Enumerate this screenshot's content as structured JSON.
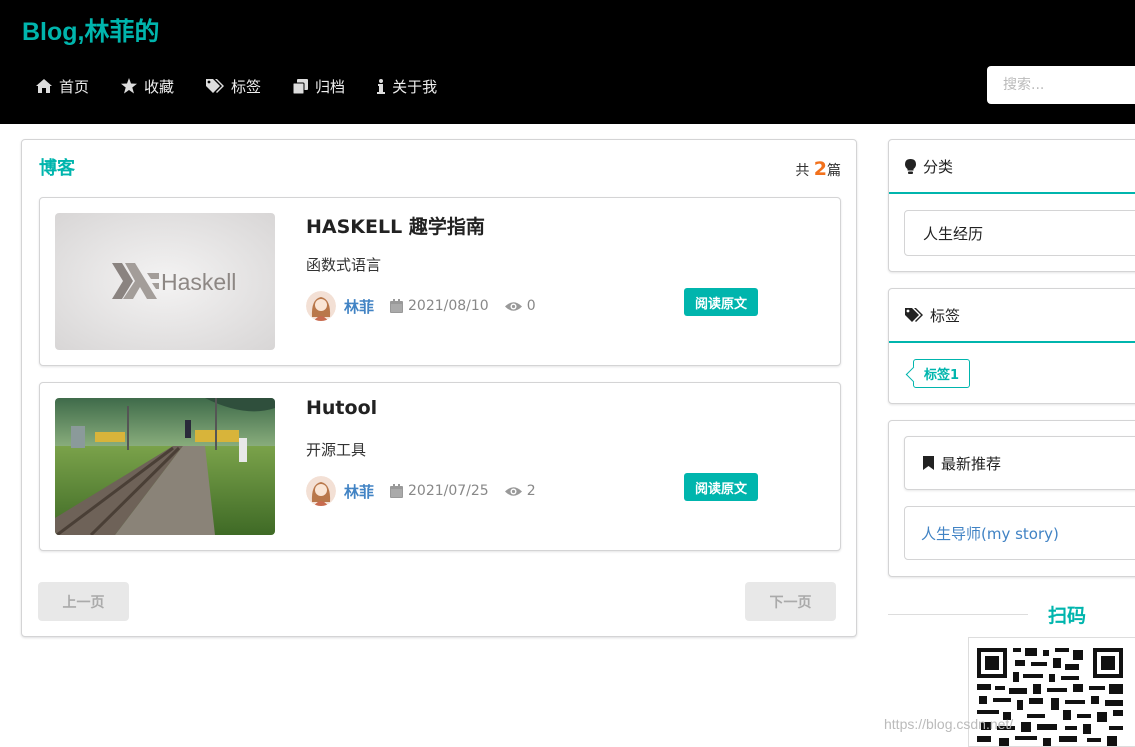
{
  "header": {
    "logo": "Blog,林菲的",
    "nav": [
      {
        "label": "首页",
        "icon": "home-icon"
      },
      {
        "label": "收藏",
        "icon": "star-icon"
      },
      {
        "label": "标签",
        "icon": "tags-icon"
      },
      {
        "label": "归档",
        "icon": "clone-icon"
      },
      {
        "label": "关于我",
        "icon": "info-icon"
      }
    ],
    "search_placeholder": "搜索..."
  },
  "main": {
    "title": "博客",
    "count_prefix": "共",
    "count": "2",
    "count_suffix": "篇",
    "posts": [
      {
        "title": "HASKELL 趣学指南",
        "description": "函数式语言",
        "thumb_text": "Haskell",
        "author": "林菲",
        "date": "2021/08/10",
        "views": "0",
        "read_label": "阅读原文"
      },
      {
        "title": "Hutool",
        "description": "开源工具",
        "author": "林菲",
        "date": "2021/07/25",
        "views": "2",
        "read_label": "阅读原文"
      }
    ],
    "prev_label": "上一页",
    "next_label": "下一页"
  },
  "sidebar": {
    "category_title": "分类",
    "categories": [
      "人生经历"
    ],
    "tag_title": "标签",
    "tags": [
      "标签1"
    ],
    "recommend_title": "最新推荐",
    "recommendations": [
      "人生导师(my story)"
    ],
    "scan_title": "扫码"
  },
  "watermark": "https://blog.csdn.net/",
  "colors": {
    "accent": "#00b5ad",
    "header_bg": "#000000",
    "link": "#4183c4",
    "count": "#f2711c"
  }
}
